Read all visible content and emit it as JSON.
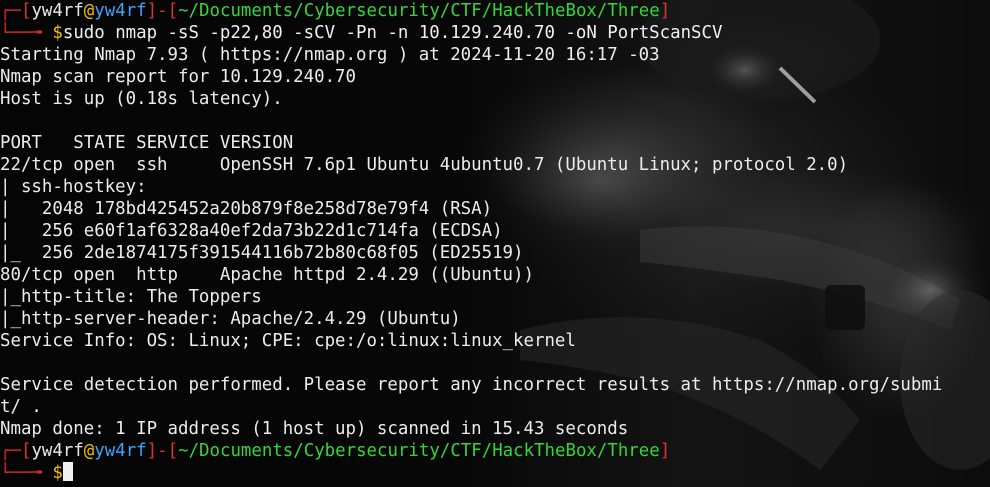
{
  "terminal": {
    "prompt1": {
      "corner_top": "┌─",
      "open_bracket": "[",
      "user": "yw4rf",
      "at": "@",
      "host": "yw4rf",
      "close_bracket": "]",
      "dash": "-",
      "path_open": "[",
      "path": "~/Documents/Cybersecurity/CTF/HackTheBox/Three",
      "path_close": "]",
      "corner_bottom": "└──╼ ",
      "dollar": "$",
      "command": "sudo nmap -sS -p22,80 -sCV -Pn -n 10.129.240.70 -oN PortScanSCV"
    },
    "output": [
      "Starting Nmap 7.93 ( https://nmap.org ) at 2024-11-20 16:17 -03",
      "Nmap scan report for 10.129.240.70",
      "Host is up (0.18s latency).",
      "",
      "PORT   STATE SERVICE VERSION",
      "22/tcp open  ssh     OpenSSH 7.6p1 Ubuntu 4ubuntu0.7 (Ubuntu Linux; protocol 2.0)",
      "| ssh-hostkey:",
      "|   2048 178bd425452a20b879f8e258d78e79f4 (RSA)",
      "|   256 e60f1af6328a40ef2da73b22d1c714fa (ECDSA)",
      "|_  256 2de1874175f391544116b72b80c68f05 (ED25519)",
      "80/tcp open  http    Apache httpd 2.4.29 ((Ubuntu))",
      "|_http-title: The Toppers",
      "|_http-server-header: Apache/2.4.29 (Ubuntu)",
      "Service Info: OS: Linux; CPE: cpe:/o:linux:linux_kernel",
      "",
      "Service detection performed. Please report any incorrect results at https://nmap.org/submi",
      "t/ .",
      "Nmap done: 1 IP address (1 host up) scanned in 15.43 seconds"
    ],
    "prompt2": {
      "corner_top": "┌─",
      "open_bracket": "[",
      "user": "yw4rf",
      "at": "@",
      "host": "yw4rf",
      "close_bracket": "]",
      "dash": "-",
      "path_open": "[",
      "path": "~/Documents/Cybersecurity/CTF/HackTheBox/Three",
      "path_close": "]",
      "corner_bottom": "└──╼ ",
      "dollar": "$",
      "command": ""
    }
  },
  "colors": {
    "background": "#050505",
    "text": "#e6e6e6",
    "prompt_frame": "#e03030",
    "at_sign": "#f2c200",
    "hostname": "#3da3ff",
    "path": "#35d53a",
    "dollar": "#f2c200"
  }
}
